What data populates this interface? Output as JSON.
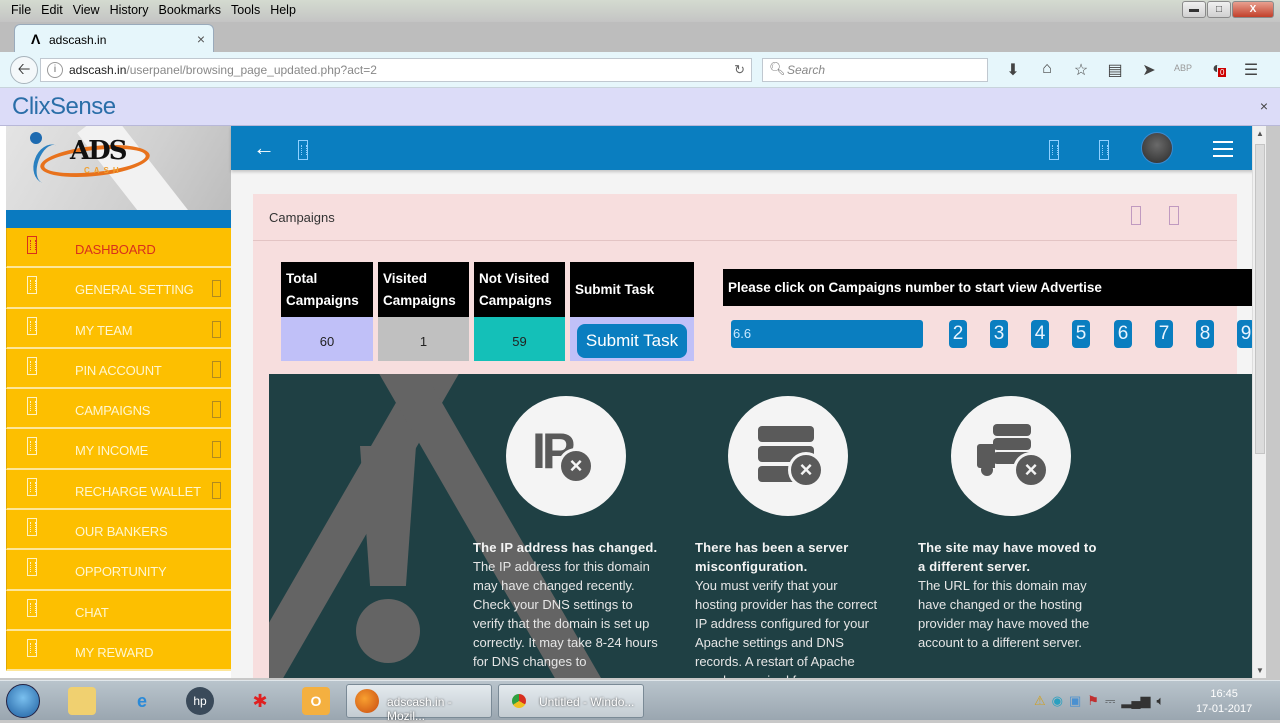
{
  "browser": {
    "menu": [
      "File",
      "Edit",
      "View",
      "History",
      "Bookmarks",
      "Tools",
      "Help"
    ],
    "tab_title": "adscash.in",
    "url_host": "adscash.in",
    "url_path": "/userpanel/browsing_page_updated.php?act=2",
    "search_placeholder": "Search",
    "notification_logo": "ClixSense",
    "addon_badge": "0",
    "abp_label": "ABP"
  },
  "sidebar": {
    "logo_text": "ADS",
    "logo_sub": "CASH",
    "items": [
      {
        "label": "DASHBOARD",
        "active": true,
        "has_chevron": false
      },
      {
        "label": "GENERAL SETTING",
        "active": false,
        "has_chevron": true
      },
      {
        "label": "MY TEAM",
        "active": false,
        "has_chevron": true
      },
      {
        "label": "PIN ACCOUNT",
        "active": false,
        "has_chevron": true
      },
      {
        "label": "CAMPAIGNS",
        "active": false,
        "has_chevron": true
      },
      {
        "label": "MY INCOME",
        "active": false,
        "has_chevron": true
      },
      {
        "label": "RECHARGE WALLET",
        "active": false,
        "has_chevron": true
      },
      {
        "label": "OUR BANKERS",
        "active": false,
        "has_chevron": false
      },
      {
        "label": "OPPORTUNITY",
        "active": false,
        "has_chevron": false
      },
      {
        "label": "CHAT",
        "active": false,
        "has_chevron": false
      },
      {
        "label": "MY REWARD",
        "active": false,
        "has_chevron": false
      }
    ]
  },
  "panel": {
    "title": "Campaigns",
    "stats_headers": [
      "Total Campaigns",
      "Visited Campaigns",
      "Not Visited Campaigns",
      "Submit Task"
    ],
    "stats_values": {
      "total": "60",
      "visited": "1",
      "not_visited": "59"
    },
    "submit_label": "Submit Task",
    "advert_instruction": "Please click on Campaigns number to start view Advertise",
    "progress_text": "6.6",
    "progress_percent": 100,
    "campaign_numbers": [
      "2",
      "3",
      "4",
      "5",
      "6",
      "7",
      "8",
      "9"
    ]
  },
  "error_page": {
    "columns": [
      {
        "icon": "ip-error-icon",
        "title": "The IP address has changed.",
        "text": "The IP address for this domain may have changed recently. Check your DNS settings to verify that the domain is set up correctly. It may take 8-24 hours for DNS changes to"
      },
      {
        "icon": "server-error-icon",
        "title": "There has been a server misconfiguration.",
        "text": "You must verify that your hosting provider has the correct IP address configured for your Apache settings and DNS records. A restart of Apache may be required for"
      },
      {
        "icon": "server-moved-icon",
        "title": "The site may have moved to a different server.",
        "text": "The URL for this domain may have changed or the hosting provider may have moved the account to a different server."
      }
    ]
  },
  "taskbar": {
    "tasks": [
      "adscash.in - Mozil...",
      "Untitled - Windo..."
    ],
    "time": "16:45",
    "date": "17-01-2017"
  },
  "colors": {
    "brand_blue": "#0a7ec0",
    "sidebar_yellow": "#fdbf00",
    "active_red": "#d8301c",
    "panel_pink": "#f7dede",
    "error_bg": "#1f4044",
    "not_visited_teal": "#14c0b8",
    "total_lavender": "#c0c0f8"
  }
}
